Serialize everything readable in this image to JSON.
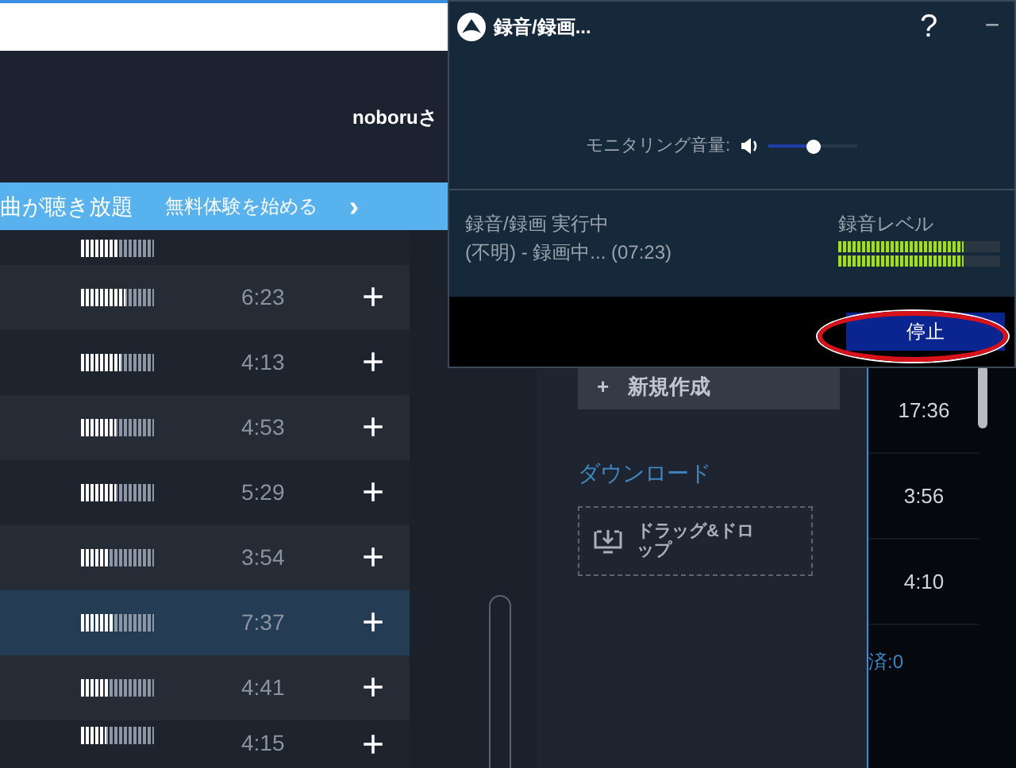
{
  "header": {
    "user": "noboruさ"
  },
  "banner": {
    "title": "曲が聴き放題",
    "link": "無料体験を始める",
    "chevron": "›"
  },
  "tracks": [
    {
      "level": 0.5,
      "selected": false
    },
    {
      "level": 0.6,
      "duration": "6:23",
      "add": "+",
      "selected": false
    },
    {
      "level": 0.55,
      "duration": "4:13",
      "add": "+",
      "selected": false
    },
    {
      "level": 0.47,
      "duration": "4:53",
      "add": "+",
      "selected": false
    },
    {
      "level": 0.47,
      "duration": "5:29",
      "add": "+",
      "selected": false
    },
    {
      "level": 0.4,
      "duration": "3:54",
      "add": "+",
      "selected": false
    },
    {
      "level": 0.45,
      "duration": "7:37",
      "add": "+",
      "selected": true
    },
    {
      "level": 0.4,
      "duration": "4:41",
      "add": "+",
      "selected": false
    },
    {
      "level": 0.35,
      "duration": "4:15",
      "add": "+",
      "selected": false
    }
  ],
  "sidebar": {
    "new_button": "新規作成",
    "new_icon": "+",
    "download_heading": "ダウンロード",
    "drop_zone": "ドラッグ&ドロップ"
  },
  "queue": {
    "durations": [
      "17:36",
      "3:56",
      "4:10"
    ],
    "status": "済:0"
  },
  "recorder": {
    "title": "録音/録画...",
    "help": "?",
    "minimize": "−",
    "monitor_label": "モニタリング音量:",
    "monitor_volume": {
      "level": 0.5
    },
    "status": "録音/録画 実行中",
    "detail": "(不明) - 録画中... (07:23)",
    "level_label": "録音レベル",
    "meters": [
      {
        "level": 0.77
      },
      {
        "level": 0.77
      }
    ],
    "stop_button": "停止"
  }
}
